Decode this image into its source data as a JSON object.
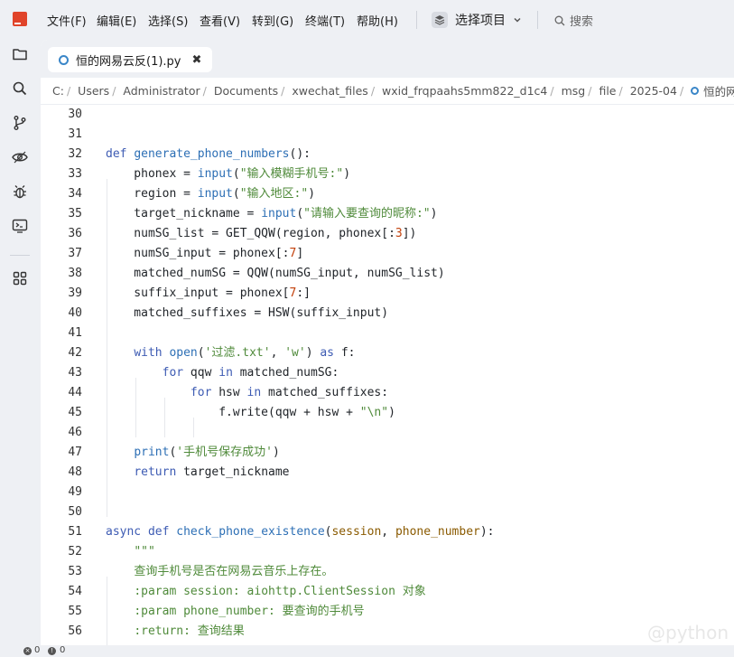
{
  "menubar": {
    "items": [
      "文件(F)",
      "编辑(E)",
      "选择(S)",
      "查看(V)",
      "转到(G)",
      "终端(T)",
      "帮助(H)"
    ],
    "project_label": "选择项目",
    "search_label": "搜索"
  },
  "tab": {
    "title": "恒的网易云反(1).py",
    "close": "✖"
  },
  "breadcrumb": [
    "C:",
    "Users",
    "Administrator",
    "Documents",
    "xwechat_files",
    "wxid_frqpaahs5mm822_d1c4",
    "msg",
    "file",
    "2025-04",
    "恒的网易"
  ],
  "status": {
    "errors": "0",
    "warnings": "0"
  },
  "watermark": "@python"
}
